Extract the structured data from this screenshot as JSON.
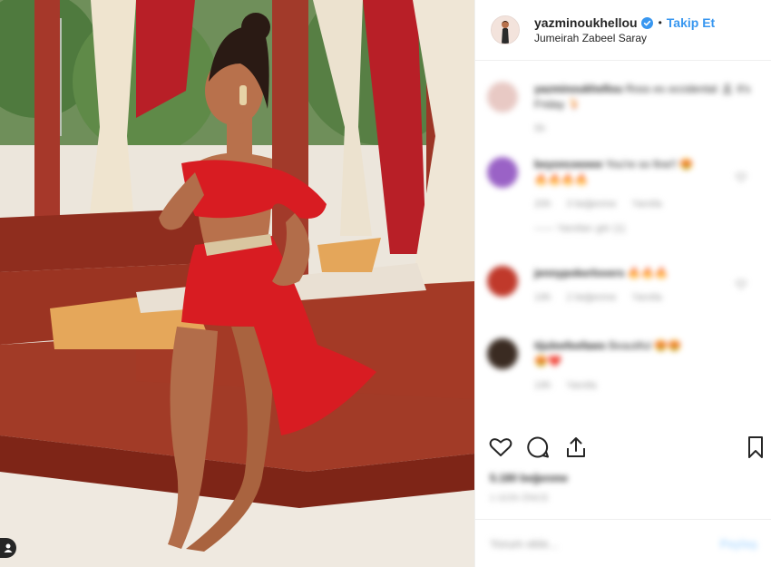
{
  "header": {
    "username": "yazminoukhellou",
    "dot": "•",
    "follow_label": "Takip Et",
    "location": "Jumeirah Zabeel Saray"
  },
  "comments": [
    {
      "user": "yazminoukhellou",
      "text": "Ross es occidental 🏝 It's Friday 🍹",
      "meta": [
        "5h"
      ],
      "avatar_color": "#e8c9c4"
    },
    {
      "user": "beyonceeeee",
      "text": "You're so fine!! 😍",
      "extra": "🔥🔥🔥🔥",
      "meta": [
        "20h",
        "3 beğenme",
        "Yanıtla"
      ],
      "replies": "—— Yanıtları gör (1)",
      "avatar_color": "#9a62c6"
    },
    {
      "user": "jennypokerlovers",
      "text": "🔥🔥🔥",
      "meta": [
        "19h",
        "2 beğenme",
        "Yanıtla"
      ],
      "avatar_color": "#c0392b"
    },
    {
      "user": "tijuleefeefaws",
      "text": "Beautiful 😍😍",
      "extra": "😍❤️",
      "meta": [
        "19h",
        "Yanıtla"
      ],
      "avatar_color": "#3a2b22"
    }
  ],
  "actions": {
    "icons": [
      "heart-icon",
      "comment-icon",
      "share-icon",
      "bookmark-icon"
    ]
  },
  "likes": "5.180 beğenme",
  "time": "1 GÜN ÖNCE",
  "add_comment": {
    "placeholder": "Yorum ekle...",
    "share_label": "Paylaş"
  },
  "colors": {
    "follow_blue": "#3897f0",
    "verified_blue": "#3897f0",
    "dress_red": "#d81c22"
  }
}
